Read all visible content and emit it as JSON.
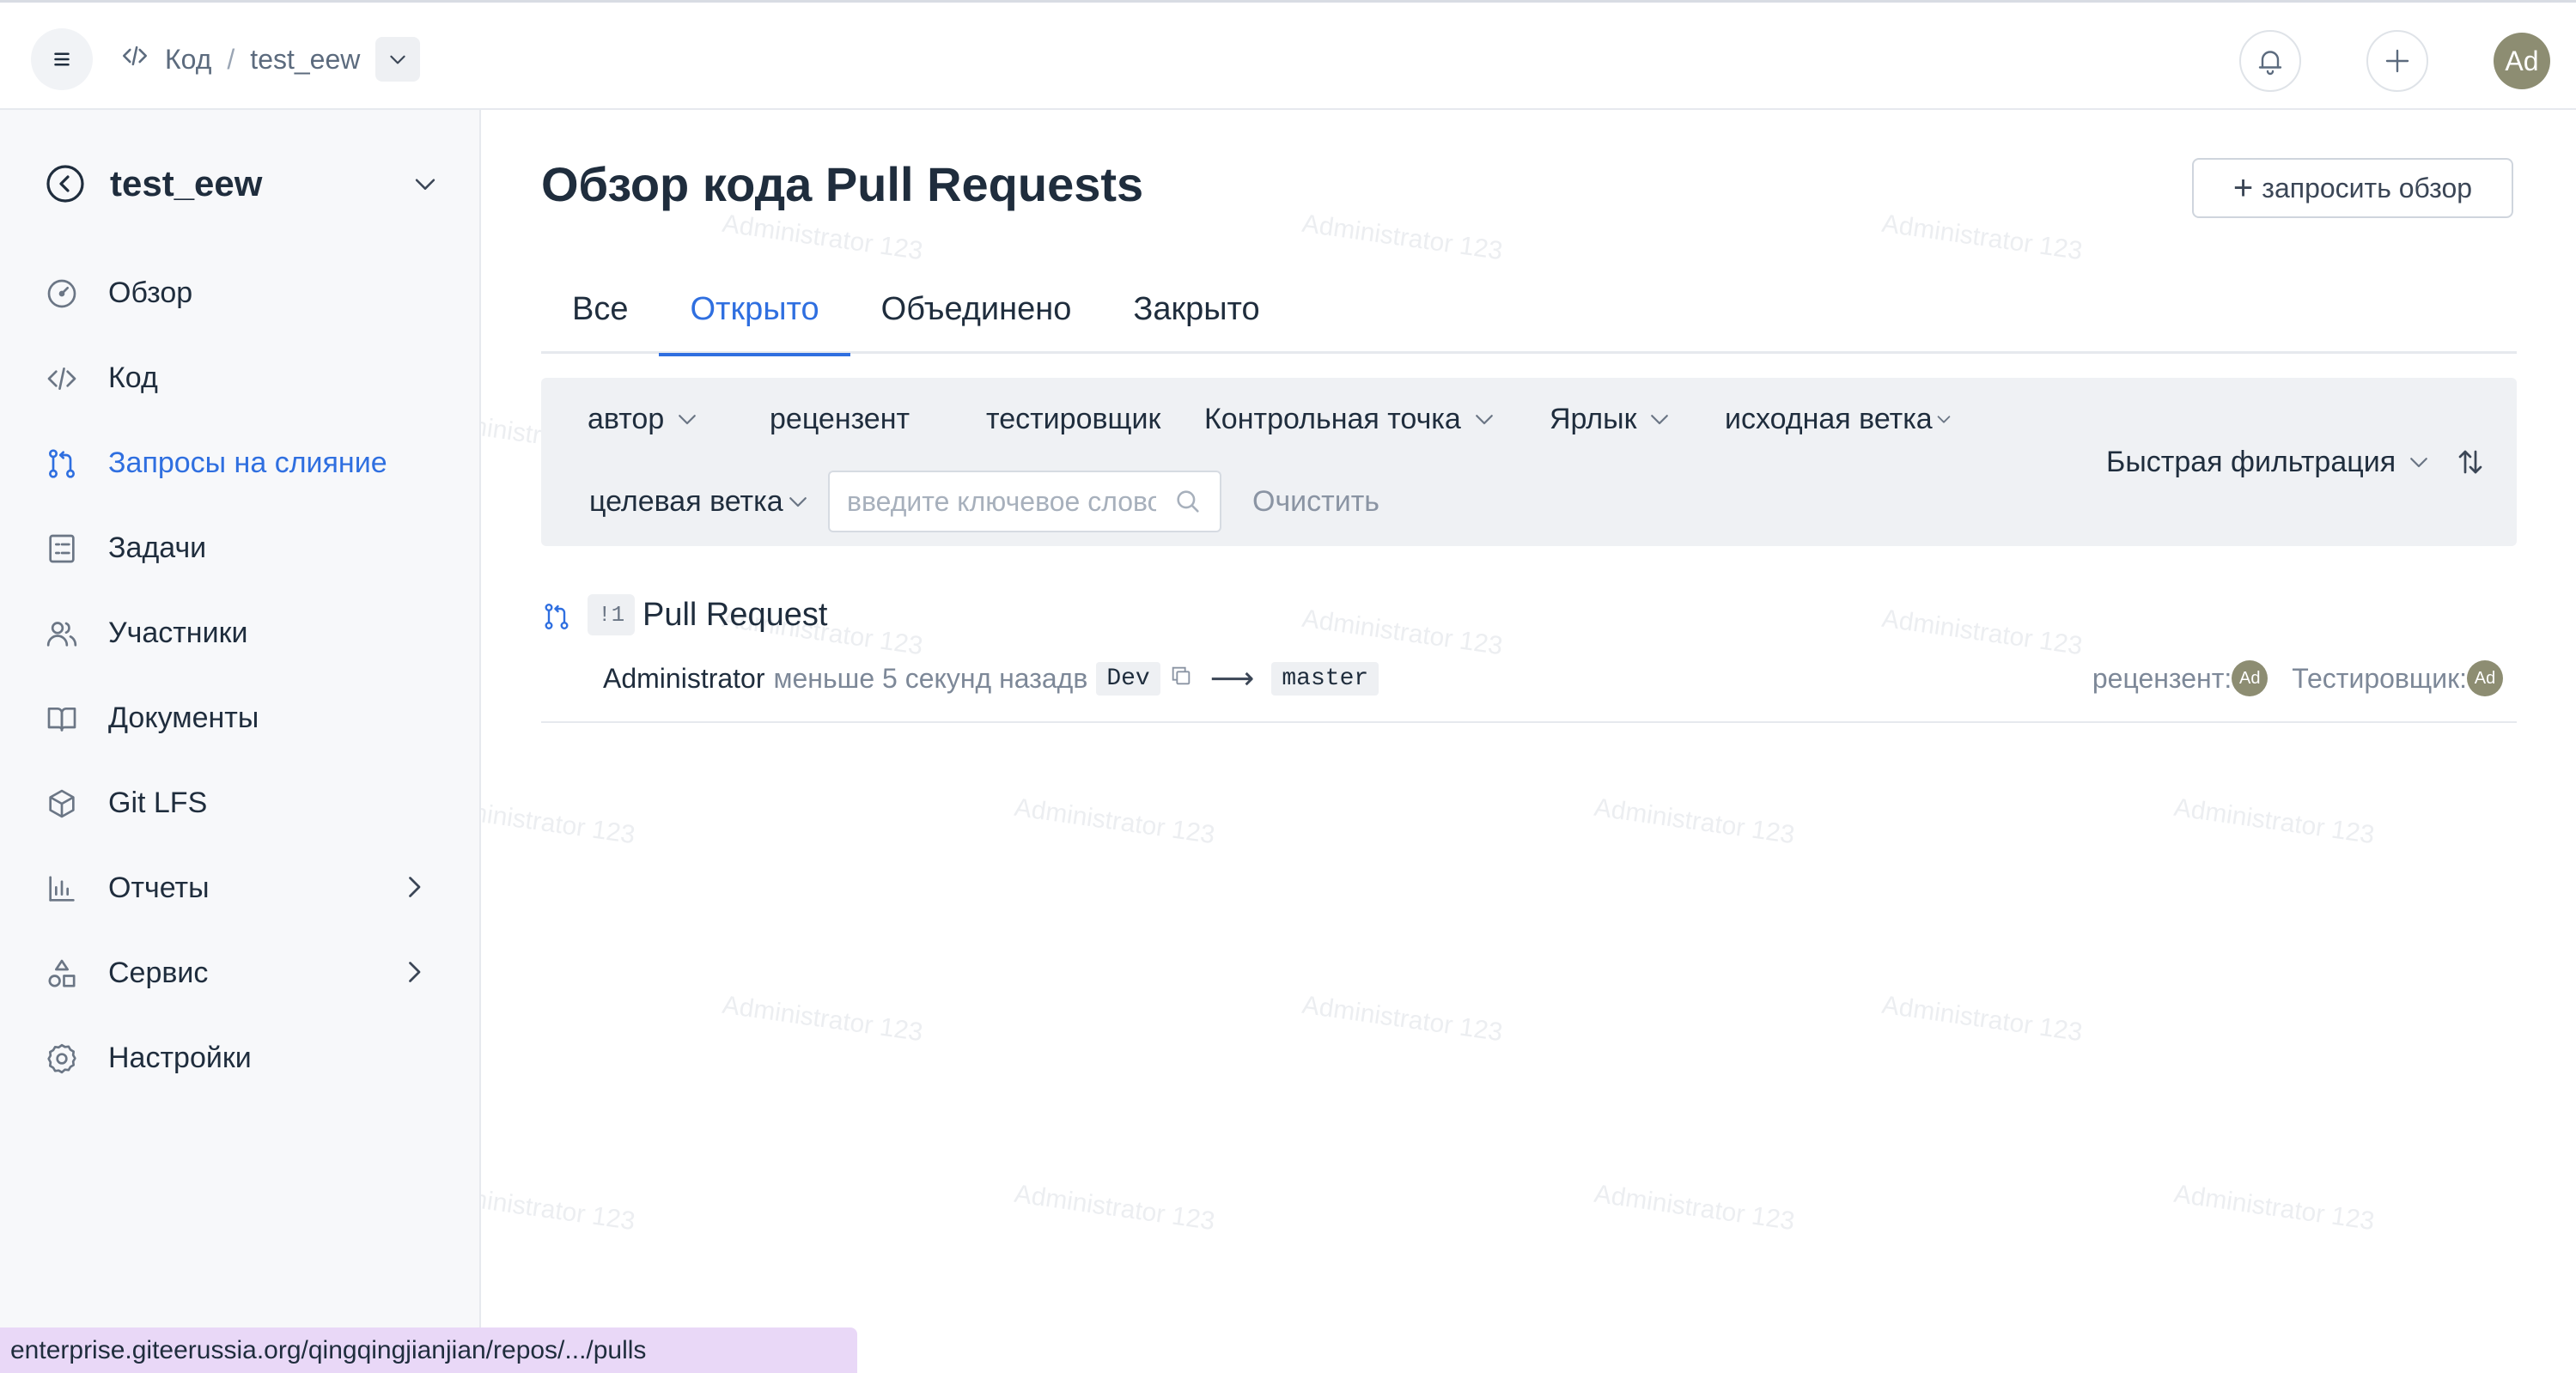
{
  "topbar": {
    "breadcrumb": [
      "Код",
      "test_eew"
    ],
    "breadcrumb_sep": "/",
    "avatar_initials": "Ad"
  },
  "sidebar": {
    "repo_name": "test_eew",
    "items": [
      {
        "label": "Обзор",
        "icon": "dashboard-icon"
      },
      {
        "label": "Код",
        "icon": "code-icon"
      },
      {
        "label": "Запросы на слияние",
        "icon": "pull-request-icon",
        "active": true
      },
      {
        "label": "Задачи",
        "icon": "tasks-icon"
      },
      {
        "label": "Участники",
        "icon": "members-icon"
      },
      {
        "label": "Документы",
        "icon": "book-icon"
      },
      {
        "label": "Git LFS",
        "icon": "package-icon"
      },
      {
        "label": "Отчеты",
        "icon": "chart-icon"
      },
      {
        "label": "Сервис",
        "icon": "shapes-icon"
      },
      {
        "label": "Настройки",
        "icon": "gear-icon"
      }
    ]
  },
  "main": {
    "title": "Обзор кода Pull Requests",
    "request_review_label": "запросить обзор",
    "tabs": [
      "Все",
      "Открыто",
      "Объединено",
      "Закрыто"
    ],
    "active_tab": "Открыто",
    "filters": {
      "author": "автор",
      "reviewer": "рецензент",
      "tester": "тестировщик",
      "milestone": "Контрольная точка",
      "label": "Ярлык",
      "source_branch": "исходная ветка",
      "target_branch": "целевая ветка",
      "search_placeholder": "введите ключевое слово",
      "clear": "Очистить",
      "quick_filter": "Быстрая фильтрация"
    },
    "pull_requests": [
      {
        "number": "!1",
        "title": "Pull Request",
        "author": "Administrator",
        "time": "меньше 5 секунд назадв",
        "source": "Dev",
        "target": "master",
        "reviewer_label": "рецензент:",
        "tester_label": "Тестировщик:",
        "reviewer_avatar": "Ad",
        "tester_avatar": "Ad"
      }
    ]
  },
  "watermark": "Administrator 123",
  "status_url": "enterprise.giteerussia.org/qingqingjianjian/repos/.../pulls",
  "colors": {
    "accent": "#2f6fe0",
    "avatar": "#8d8d72",
    "status_bg": "#e9d8f7"
  }
}
